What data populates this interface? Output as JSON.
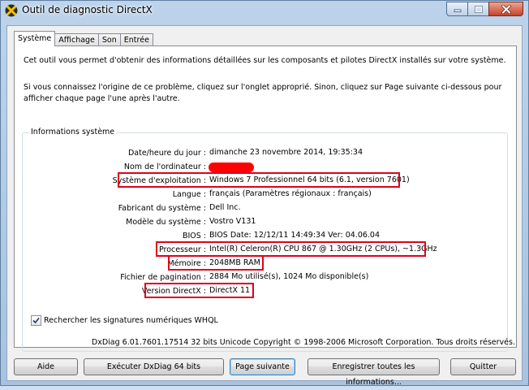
{
  "window": {
    "title": "Outil de diagnostic DirectX"
  },
  "tabs": [
    {
      "label": "Système",
      "active": true
    },
    {
      "label": "Affichage",
      "active": false
    },
    {
      "label": "Son",
      "active": false
    },
    {
      "label": "Entrée",
      "active": false
    }
  ],
  "intro": {
    "line1": "Cet outil vous permet d'obtenir des informations détaillées sur les composants et pilotes DirectX installés sur votre système.",
    "line2": "Si vous connaissez l'origine de ce problème, cliquez sur l'onglet approprié. Sinon, cliquez sur Page suivante ci-dessous pour afficher chaque page l'une après l'autre."
  },
  "sysinfo": {
    "group_title": "Informations système",
    "rows": [
      {
        "label": "Date/heure du jour :",
        "value": "dimanche 23 novembre 2014, 19:35:34"
      },
      {
        "label": "Nom de l'ordinateur :",
        "value": ""
      },
      {
        "label": "Système d'exploitation :",
        "value": "Windows 7 Professionnel 64 bits (6.1, version 7601)"
      },
      {
        "label": "Langue :",
        "value": "français (Paramètres régionaux : français)"
      },
      {
        "label": "Fabricant du système :",
        "value": "Dell Inc."
      },
      {
        "label": "Modèle du système :",
        "value": "Vostro V131"
      },
      {
        "label": "BIOS :",
        "value": "BIOS Date: 12/12/11 14:49:34 Ver: 04.06.04"
      },
      {
        "label": "Processeur :",
        "value": "Intel(R) Celeron(R) CPU 867 @ 1.30GHz (2 CPUs), ~1.3GHz"
      },
      {
        "label": "Mémoire :",
        "value": "2048MB RAM"
      },
      {
        "label": "Fichier de pagination :",
        "value": "2884 Mo utilisé(s), 1024 Mo disponible(s)"
      },
      {
        "label": "Version DirectX :",
        "value": "DirectX 11"
      }
    ],
    "redaction_color": "#ff0000",
    "highlight_color": "#e0001b"
  },
  "whql": {
    "label": "Rechercher les signatures numériques WHQL",
    "checked": true
  },
  "copyright": "DxDiag 6.01.7601.17514 32 bits Unicode Copyright © 1998-2006 Microsoft Corporation. Tous droits réservés.",
  "buttons": {
    "help": "Aide",
    "run64": "Exécuter DxDiag 64 bits",
    "next": "Page suivante",
    "save": "Enregistrer toutes les informations...",
    "quit": "Quitter"
  },
  "icons": {
    "app": "directx-x-icon",
    "minimize": "minimize-icon",
    "maximize": "maximize-icon",
    "close": "close-icon",
    "check": "checkmark-icon"
  }
}
